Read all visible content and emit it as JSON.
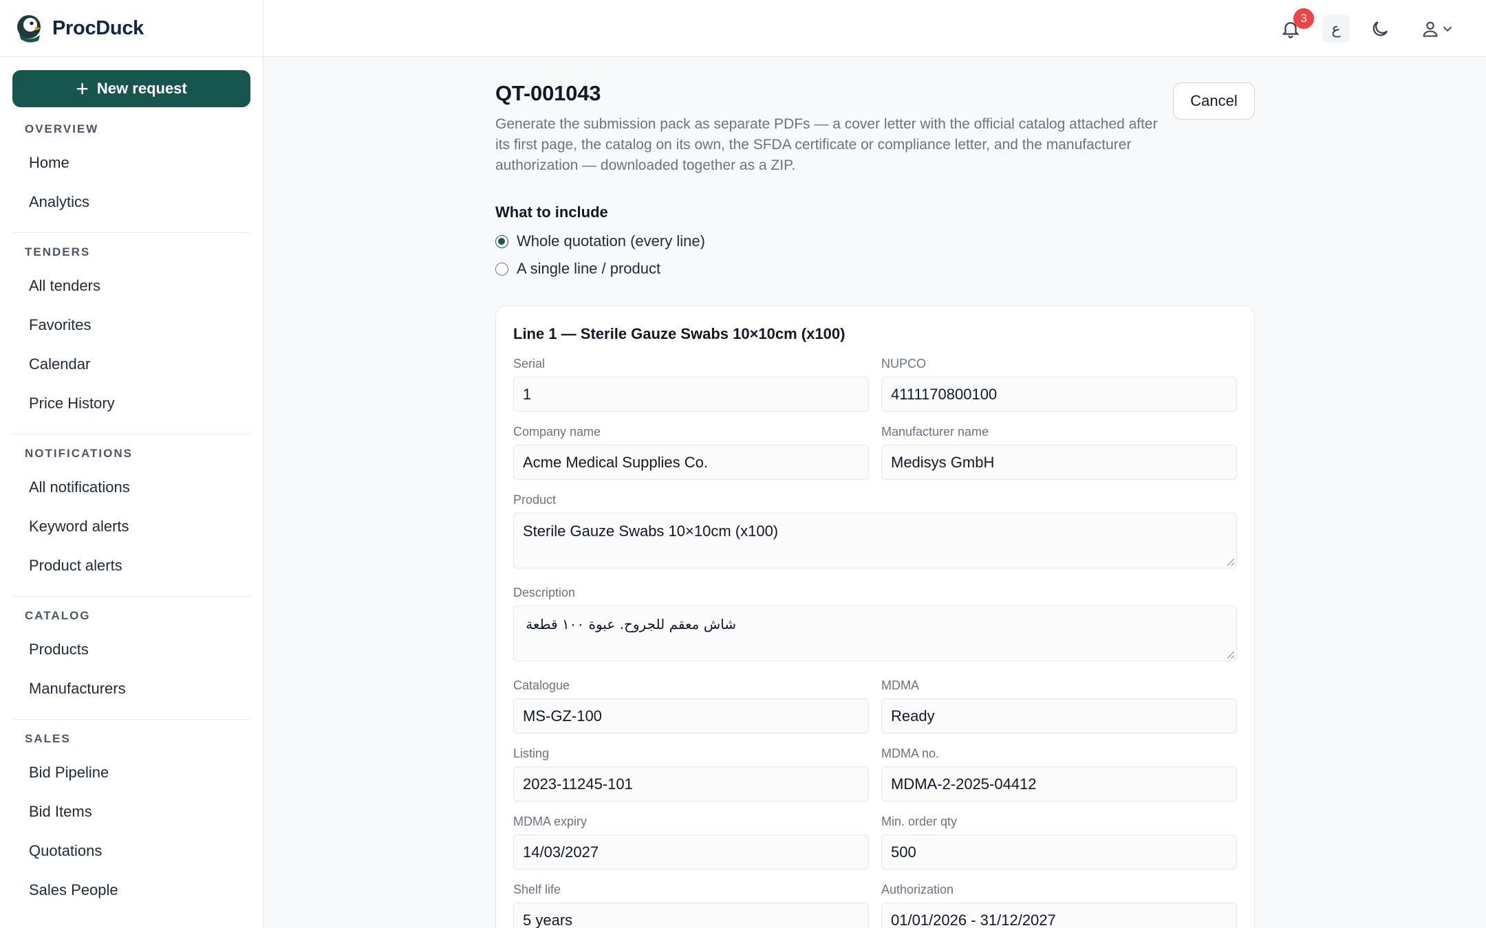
{
  "brand": {
    "name": "ProcDuck"
  },
  "sidebar": {
    "new_request": "New request",
    "sections": [
      {
        "heading": "OVERVIEW",
        "items": [
          "Home",
          "Analytics"
        ]
      },
      {
        "heading": "TENDERS",
        "items": [
          "All tenders",
          "Favorites",
          "Calendar",
          "Price History"
        ]
      },
      {
        "heading": "NOTIFICATIONS",
        "items": [
          "All notifications",
          "Keyword alerts",
          "Product alerts"
        ]
      },
      {
        "heading": "CATALOG",
        "items": [
          "Products",
          "Manufacturers"
        ]
      },
      {
        "heading": "SALES",
        "items": [
          "Bid Pipeline",
          "Bid Items",
          "Quotations",
          "Sales People"
        ]
      }
    ]
  },
  "topbar": {
    "notifications_count": "3",
    "language_label": "ع"
  },
  "page": {
    "title": "QT-001043",
    "subtitle": "Generate the submission pack as separate PDFs — a cover letter with the official catalog attached after its first page, the catalog on its own, the SFDA certificate or compliance letter, and the manufacturer authorization — downloaded together as a ZIP.",
    "cancel": "Cancel",
    "include_label": "What to include",
    "options": [
      "Whole quotation (every line)",
      "A single line / product"
    ],
    "selected_option": 0
  },
  "line": {
    "title": "Line 1 — Sterile Gauze Swabs 10×10cm (x100)",
    "serial_label": "Serial",
    "serial": "1",
    "nupco_label": "NUPCO",
    "nupco": "4111170800100",
    "company_label": "Company name",
    "company": "Acme Medical Supplies Co.",
    "manufacturer_label": "Manufacturer name",
    "manufacturer": "Medisys GmbH",
    "product_label": "Product",
    "product": "Sterile Gauze Swabs 10×10cm (x100)",
    "description_label": "Description",
    "description": "شاش معقم للجروح. عبوة ١٠٠ قطعة",
    "catalogue_label": "Catalogue",
    "catalogue": "MS-GZ-100",
    "mdma_label": "MDMA",
    "mdma": "Ready",
    "listing_label": "Listing",
    "listing": "2023-11245-101",
    "mdma_no_label": "MDMA no.",
    "mdma_no": "MDMA-2-2025-04412",
    "mdma_expiry_label": "MDMA expiry",
    "mdma_expiry": "14/03/2027",
    "min_order_label": "Min. order qty",
    "min_order": "500",
    "shelf_life_label": "Shelf life",
    "shelf_life": "5 years",
    "authorization_label": "Authorization",
    "authorization": "01/01/2026 - 31/12/2027"
  }
}
